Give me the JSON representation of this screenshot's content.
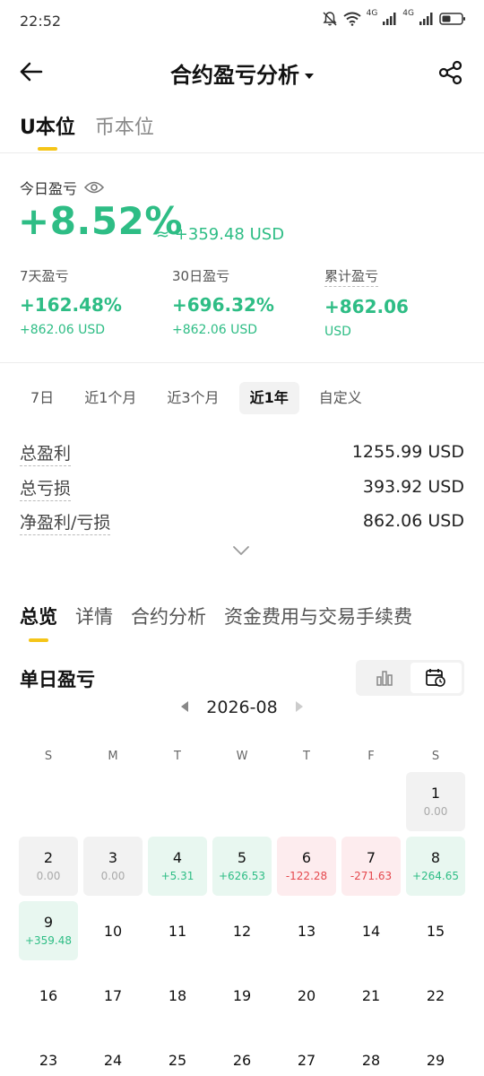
{
  "status_bar": {
    "time": "22:52",
    "net1": "4G",
    "net2": "4G",
    "icons": [
      "bell-off-icon",
      "wifi-icon",
      "signal-icon",
      "signal-icon",
      "battery-icon"
    ]
  },
  "header": {
    "title": "合约盈亏分析",
    "back_icon": "arrow-left-icon",
    "share_icon": "share-icon"
  },
  "unit_tabs": [
    {
      "label": "U本位",
      "active": true
    },
    {
      "label": "币本位",
      "active": false
    }
  ],
  "today": {
    "label": "今日盈亏",
    "pct": "+8.52%",
    "usd": "≈ +359.48 USD"
  },
  "stats": [
    {
      "label": "7天盈亏",
      "main": "+162.48%",
      "sub": "+862.06 USD",
      "dotted": false
    },
    {
      "label": "30日盈亏",
      "main": "+696.32%",
      "sub": "+862.06 USD",
      "dotted": false
    },
    {
      "label": "累计盈亏",
      "main": "+862.06",
      "sub": "USD",
      "dotted": true
    }
  ],
  "period_tabs": [
    {
      "label": "7日",
      "active": false
    },
    {
      "label": "近1个月",
      "active": false
    },
    {
      "label": "近3个月",
      "active": false
    },
    {
      "label": "近1年",
      "active": true
    },
    {
      "label": "自定义",
      "active": false
    }
  ],
  "summary": [
    {
      "label": "总盈利",
      "value": "1255.99 USD"
    },
    {
      "label": "总亏损",
      "value": "393.92 USD"
    },
    {
      "label": "净盈利/亏损",
      "value": "862.06 USD"
    }
  ],
  "section_tabs": [
    {
      "label": "总览",
      "active": true
    },
    {
      "label": "详情",
      "active": false
    },
    {
      "label": "合约分析",
      "active": false
    },
    {
      "label": "资金费用与交易手续费",
      "active": false
    }
  ],
  "daily": {
    "title": "单日盈亏",
    "month": "2026-08",
    "weekdays": [
      "S",
      "M",
      "T",
      "W",
      "T",
      "F",
      "S"
    ],
    "leading_blanks": 6,
    "days": [
      {
        "day": "1",
        "value": "0.00",
        "state": "neutral"
      },
      {
        "day": "2",
        "value": "0.00",
        "state": "neutral"
      },
      {
        "day": "3",
        "value": "0.00",
        "state": "neutral"
      },
      {
        "day": "4",
        "value": "+5.31",
        "state": "gain"
      },
      {
        "day": "5",
        "value": "+626.53",
        "state": "gain"
      },
      {
        "day": "6",
        "value": "-122.28",
        "state": "loss"
      },
      {
        "day": "7",
        "value": "-271.63",
        "state": "loss"
      },
      {
        "day": "8",
        "value": "+264.65",
        "state": "gain"
      },
      {
        "day": "9",
        "value": "+359.48",
        "state": "gain"
      },
      {
        "day": "10",
        "value": "",
        "state": "plain"
      },
      {
        "day": "11",
        "value": "",
        "state": "plain"
      },
      {
        "day": "12",
        "value": "",
        "state": "plain"
      },
      {
        "day": "13",
        "value": "",
        "state": "plain"
      },
      {
        "day": "14",
        "value": "",
        "state": "plain"
      },
      {
        "day": "15",
        "value": "",
        "state": "plain"
      },
      {
        "day": "16",
        "value": "",
        "state": "plain"
      },
      {
        "day": "17",
        "value": "",
        "state": "plain"
      },
      {
        "day": "18",
        "value": "",
        "state": "plain"
      },
      {
        "day": "19",
        "value": "",
        "state": "plain"
      },
      {
        "day": "20",
        "value": "",
        "state": "plain"
      },
      {
        "day": "21",
        "value": "",
        "state": "plain"
      },
      {
        "day": "22",
        "value": "",
        "state": "plain"
      },
      {
        "day": "23",
        "value": "",
        "state": "plain"
      },
      {
        "day": "24",
        "value": "",
        "state": "plain"
      },
      {
        "day": "25",
        "value": "",
        "state": "plain"
      },
      {
        "day": "26",
        "value": "",
        "state": "plain"
      },
      {
        "day": "27",
        "value": "",
        "state": "plain"
      },
      {
        "day": "28",
        "value": "",
        "state": "plain"
      },
      {
        "day": "29",
        "value": "",
        "state": "plain"
      }
    ]
  },
  "colors": {
    "gain": "#2ebd85",
    "loss": "#e5484d",
    "accent": "#f5c518"
  }
}
